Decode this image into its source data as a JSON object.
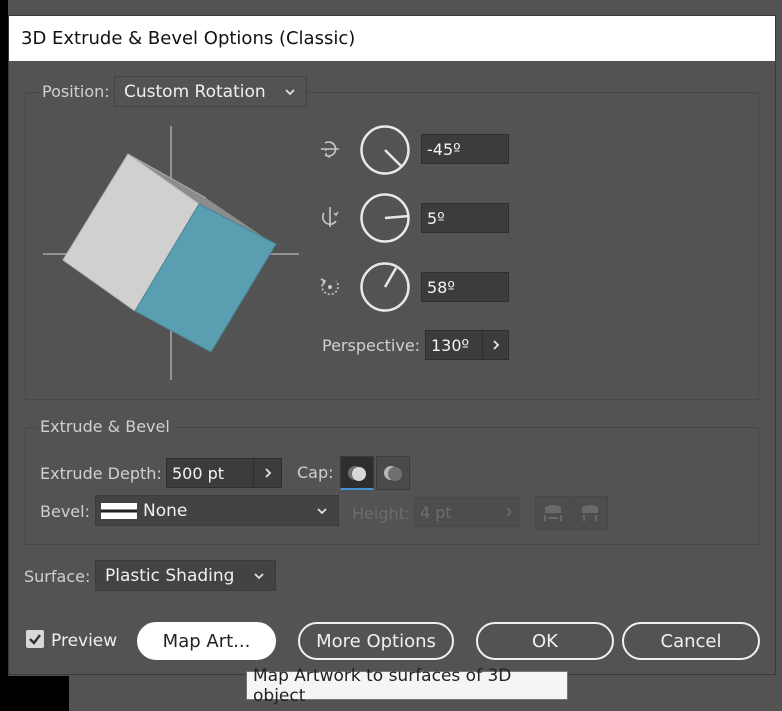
{
  "dialog": {
    "title": "3D Extrude & Bevel Options (Classic)"
  },
  "position": {
    "label": "Position:",
    "value": "Custom Rotation",
    "rotation_x": "-45º",
    "rotation_y": "5º",
    "rotation_z": "58º",
    "perspective_label": "Perspective:",
    "perspective_value": "130º",
    "cube_front_color": "#5a9fb1",
    "cube_side_color": "#d0d0d0"
  },
  "extrude": {
    "group_label": "Extrude & Bevel",
    "depth_label": "Extrude Depth:",
    "depth_value": "500 pt",
    "cap_label": "Cap:",
    "bevel_label": "Bevel:",
    "bevel_value": "None",
    "height_label": "Height:",
    "height_value": "4 pt"
  },
  "surface": {
    "label": "Surface:",
    "value": "Plastic Shading"
  },
  "footer": {
    "preview_label": "Preview",
    "preview_checked": true,
    "map_art_label": "Map Art...",
    "more_options_label": "More Options",
    "ok_label": "OK",
    "cancel_label": "Cancel"
  },
  "tooltip": {
    "text": "Map Artwork to surfaces of 3D object"
  }
}
